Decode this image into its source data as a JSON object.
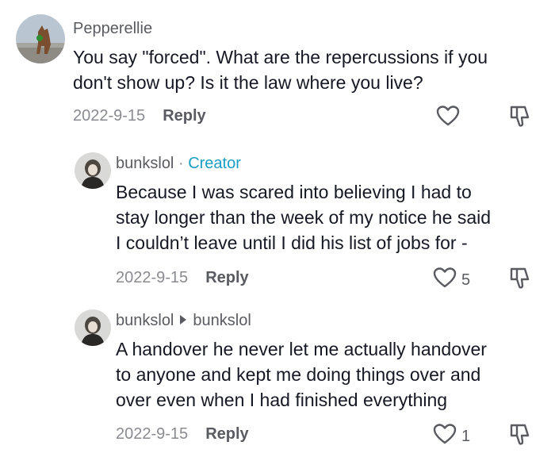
{
  "comments": [
    {
      "username": "Pepperellie",
      "lines": [
        "You say \"forced\". What are the repercussions if you",
        "don't show up? Is it the law where you live?"
      ],
      "date": "2022-9-15",
      "reply_label": "Reply",
      "like_count": ""
    },
    {
      "username": "bunkslol",
      "separator": "·",
      "creator_label": "Creator",
      "lines": [
        "Because I was scared into believing I had to",
        "stay longer than the week of my notice he said",
        "I couldn’t leave until I did his list of jobs for -"
      ],
      "date": "2022-9-15",
      "reply_label": "Reply",
      "like_count": "5"
    },
    {
      "username": "bunkslol",
      "reply_to": "bunkslol",
      "lines": [
        "A handover he never let me actually handover",
        "to anyone and kept me doing things over and",
        "over even when I had finished everything"
      ],
      "date": "2022-9-15",
      "reply_label": "Reply",
      "like_count": "1"
    }
  ],
  "colors": {
    "text": "#161823",
    "secondary": "#8a8b91",
    "creator": "#1a9ec4"
  },
  "icons": [
    "heart-icon",
    "dislike-icon",
    "reply-arrow-icon"
  ]
}
